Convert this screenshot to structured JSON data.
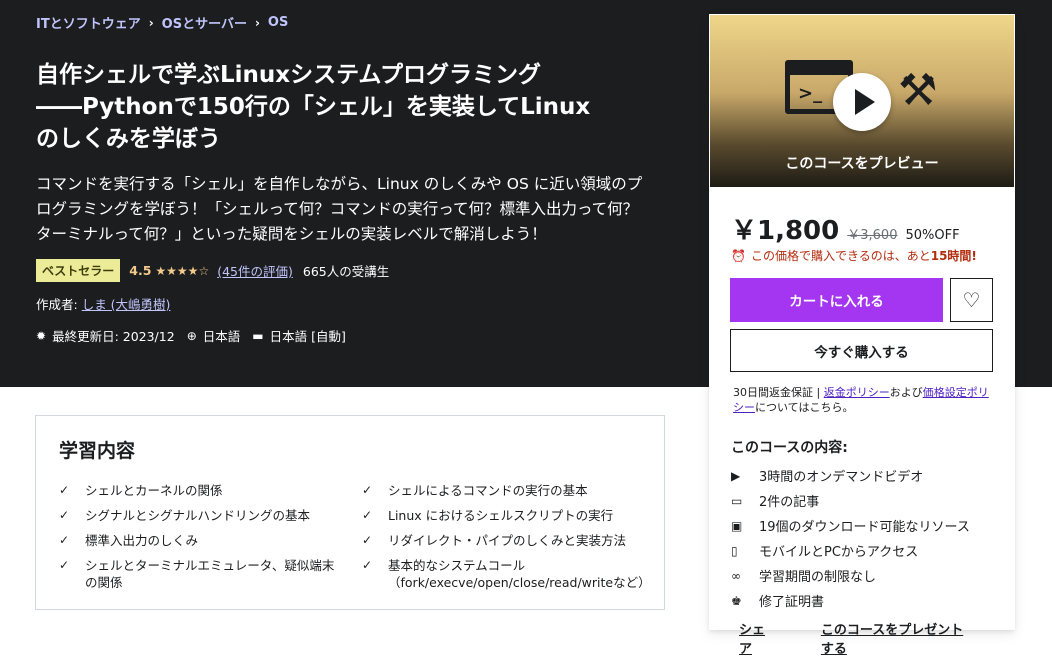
{
  "breadcrumb": [
    "ITとソフトウェア",
    "OSとサーバー",
    "OS"
  ],
  "course": {
    "title_lines": [
      "自作シェルで学ぶLinuxシステムプログラミング",
      "――Pythonで150行の「シェル」を実装してLinux",
      "のしくみを学ぼう"
    ],
    "subtitle_lines": [
      "コマンドを実行する「シェル」を自作しながら、Linux のしくみや OS に近い領域のプ",
      "ログラミングを学ぼう！「シェルって何？コマンドの実行って何？標準入出力って何？",
      "ターミナルって何？」といった疑問をシェルの実装レベルで解消しよう！"
    ],
    "badge": "ベストセラー",
    "rating": "4.5",
    "stars": "★★★★☆",
    "rating_count": "(45件の評価)",
    "students": "665人の受講生",
    "author_label": "作成者:",
    "author": "しま (大嶋勇樹)",
    "updated": "最終更新日: 2023/12",
    "language": "日本語",
    "captions": "日本語 [自動]"
  },
  "sidebar": {
    "preview_label": "このコースをプレビュー",
    "price": "￥1,800",
    "original_price": "￥3,600",
    "discount": "50%OFF",
    "timer_text": "この価格で購入できるのは、あと",
    "timer_hours": "15時間!",
    "cart_button": "カートに入れる",
    "buy_button": "今すぐ購入する",
    "guarantee_prefix": "30日間返金保証 | ",
    "refund_policy": "返金ポリシー",
    "and_text": "および",
    "pricing_policy": "価格設定ポリシー",
    "guarantee_suffix": "についてはこちら。",
    "includes_title": "このコースの内容:",
    "includes": [
      {
        "icon": "video-icon",
        "glyph": "▶",
        "text": "3時間のオンデマンドビデオ"
      },
      {
        "icon": "file-icon",
        "glyph": "▭",
        "text": "2件の記事"
      },
      {
        "icon": "folder-download-icon",
        "glyph": "▣",
        "text": "19個のダウンロード可能なリソース"
      },
      {
        "icon": "mobile-icon",
        "glyph": "▯",
        "text": "モバイルとPCからアクセス"
      },
      {
        "icon": "infinity-icon",
        "glyph": "∞",
        "text": "学習期間の制限なし"
      },
      {
        "icon": "trophy-icon",
        "glyph": "♚",
        "text": "修了証明書"
      }
    ],
    "share": "シェア",
    "gift": "このコースをプレゼントする"
  },
  "learn": {
    "title": "学習内容",
    "col1": [
      "シェルとカーネルの関係",
      "シグナルとシグナルハンドリングの基本",
      "標準入出力のしくみ",
      "シェルとターミナルエミュレータ、疑似端末の関係"
    ],
    "col2": [
      "シェルによるコマンドの実行の基本",
      "Linux におけるシェルスクリプトの実行",
      "リダイレクト・パイプのしくみと実装方法",
      "基本的なシステムコール（fork/execve/open/close/read/writeなど）"
    ]
  },
  "colors": {
    "hero_bg": "#1c1d1f",
    "accent": "#a435f0",
    "link": "#c0c4fc",
    "badge": "#eceb98",
    "star": "#f3ca8c",
    "alert": "#b32d0f"
  }
}
